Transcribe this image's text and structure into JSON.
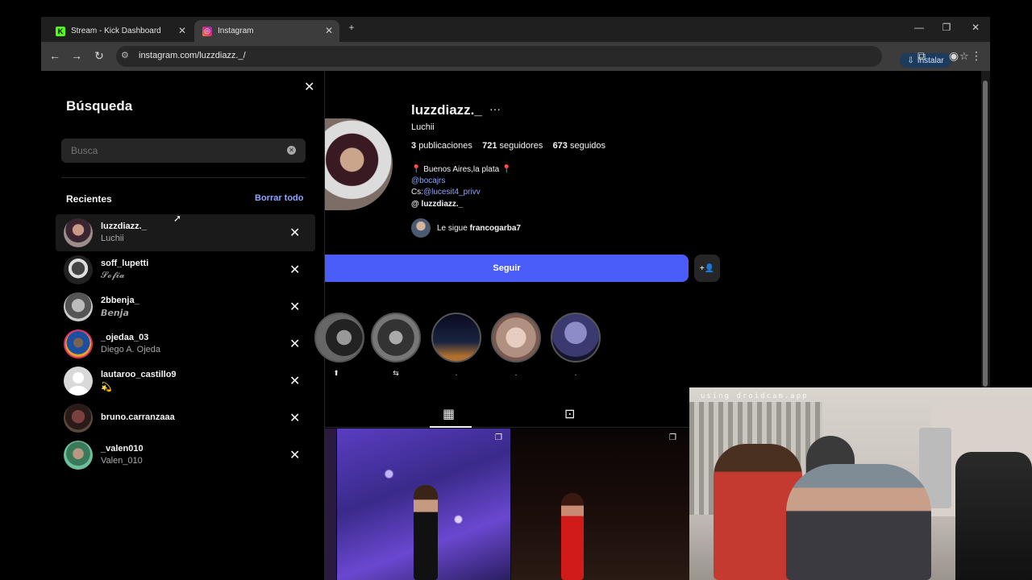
{
  "browser": {
    "tabs": [
      {
        "title": "Stream - Kick Dashboard",
        "favicon": "kick-icon",
        "active": false
      },
      {
        "title": "Instagram",
        "favicon": "instagram-icon",
        "active": true
      }
    ],
    "url": "instagram.com/luzzdiazz._/",
    "install_label": "Instalar"
  },
  "search": {
    "title": "Búsqueda",
    "placeholder": "Busca",
    "recent_label": "Recientes",
    "clear_all_label": "Borrar todo",
    "items": [
      {
        "username": "luzzdiazz._",
        "fullname": "Luchii"
      },
      {
        "username": "soff_lupetti",
        "fullname": "𝓢𝓸𝓯𝓲𝓪"
      },
      {
        "username": "2bbenja_",
        "fullname": "𝘽𝙚𝙣𝙟𝙖"
      },
      {
        "username": "_ojedaa_03",
        "fullname": "Diego A. Ojeda"
      },
      {
        "username": "lautaroo_castillo9",
        "fullname": "💫"
      },
      {
        "username": "bruno.carranzaaa",
        "fullname": ""
      },
      {
        "username": "_valen010",
        "fullname": "Valen_010"
      }
    ]
  },
  "profile": {
    "username": "luzzdiazz._",
    "more": "···",
    "name": "Luchii",
    "stats": {
      "posts_count": "3",
      "posts_label": "publicaciones",
      "followers_count": "721",
      "followers_label": "seguidores",
      "following_count": "673",
      "following_label": "seguidos"
    },
    "bio": {
      "line1": "📍 Buenos Aires,la plata 📍",
      "line2": "@bocajrs",
      "line3_prefix": "Cs:",
      "line3_link": "@lucesit4_privv",
      "threads": "luzzdiazz._"
    },
    "followed_by_prefix": "Le sigue",
    "followed_by_user": "francogarba7",
    "follow_label": "Seguir",
    "add_icon": "+👤",
    "highlights": [
      {
        "label": "⬆"
      },
      {
        "label": "⇆"
      },
      {
        "label": "."
      },
      {
        "label": "."
      },
      {
        "label": "."
      }
    ]
  },
  "webcam": {
    "overlay_text": "using droidcam.app"
  },
  "colors": {
    "follow_button": "#4a5df9",
    "link": "#8fa5ff",
    "background": "#000000",
    "input_bg": "#262626"
  }
}
